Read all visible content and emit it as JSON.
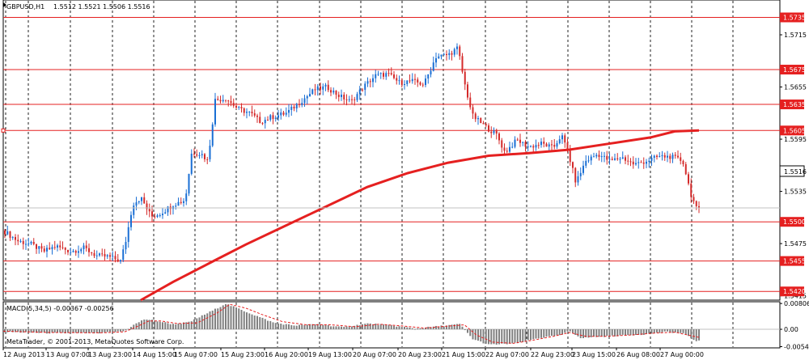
{
  "header": {
    "symbol_label": "GBPUSD,H1",
    "ohlc_label": "1.5512 1.5521 1.5506 1.5516"
  },
  "macd_label": "MACD(5,34,5) -0.00367 -0.00256",
  "copyright": "MetaTrader, © 2001-2013, MetaQuotes Software Corp.",
  "colors": {
    "bull": "#1a6fd4",
    "bear": "#d42a2a",
    "level": "#e52020",
    "ma": "#e52020",
    "grid": "#222222",
    "histogram": "#808080",
    "signal": "#e52020"
  },
  "chart_data": [
    {
      "type": "candlestick",
      "title": "GBPUSD,H1",
      "ylim": [
        1.541,
        1.5755
      ],
      "y_tick_labels": [
        "1.5715",
        "1.5655",
        "1.5595",
        "1.5535",
        "1.5475",
        "1.5415"
      ],
      "current_price": "1.5516",
      "horizontal_levels": [
        "1.5735",
        "1.5675",
        "1.5635",
        "1.5605",
        "1.5500",
        "1.5455",
        "1.5420"
      ],
      "x_tick_labels": [
        "12 Aug 2013",
        "13 Aug 07:00",
        "13 Aug 23:00",
        "14 Aug 15:00",
        "15 Aug 07:00",
        "15 Aug 23:00",
        "16 Aug 20:00",
        "19 Aug 13:00",
        "20 Aug 07:00",
        "20 Aug 23:00",
        "21 Aug 15:00",
        "22 Aug 07:00",
        "22 Aug 23:00",
        "23 Aug 15:00",
        "26 Aug 08:00",
        "27 Aug 00:00"
      ],
      "close_path": [
        [
          0,
          1.549
        ],
        [
          18,
          1.5478
        ],
        [
          35,
          1.5474
        ],
        [
          50,
          1.5466
        ],
        [
          65,
          1.5472
        ],
        [
          84,
          1.5466
        ],
        [
          100,
          1.547
        ],
        [
          115,
          1.5461
        ],
        [
          130,
          1.546
        ],
        [
          145,
          1.5455
        ],
        [
          152,
          1.548
        ],
        [
          160,
          1.552
        ],
        [
          170,
          1.5528
        ],
        [
          183,
          1.5506
        ],
        [
          195,
          1.551
        ],
        [
          210,
          1.552
        ],
        [
          225,
          1.5525
        ],
        [
          233,
          1.558
        ],
        [
          245,
          1.5578
        ],
        [
          253,
          1.557
        ],
        [
          262,
          1.564
        ],
        [
          275,
          1.5642
        ],
        [
          290,
          1.563
        ],
        [
          305,
          1.5625
        ],
        [
          318,
          1.5615
        ],
        [
          330,
          1.562
        ],
        [
          350,
          1.5625
        ],
        [
          370,
          1.564
        ],
        [
          385,
          1.5652
        ],
        [
          400,
          1.5655
        ],
        [
          415,
          1.5645
        ],
        [
          430,
          1.5638
        ],
        [
          445,
          1.5655
        ],
        [
          460,
          1.5668
        ],
        [
          475,
          1.567
        ],
        [
          490,
          1.566
        ],
        [
          505,
          1.5662
        ],
        [
          520,
          1.5658
        ],
        [
          535,
          1.569
        ],
        [
          550,
          1.5692
        ],
        [
          562,
          1.57
        ],
        [
          570,
          1.566
        ],
        [
          580,
          1.5622
        ],
        [
          595,
          1.561
        ],
        [
          610,
          1.56
        ],
        [
          620,
          1.558
        ],
        [
          635,
          1.5594
        ],
        [
          650,
          1.5586
        ],
        [
          665,
          1.559
        ],
        [
          680,
          1.5585
        ],
        [
          690,
          1.56
        ],
        [
          698,
          1.558
        ],
        [
          708,
          1.5545
        ],
        [
          720,
          1.557
        ],
        [
          735,
          1.5578
        ],
        [
          750,
          1.557
        ],
        [
          765,
          1.5574
        ],
        [
          780,
          1.5566
        ],
        [
          795,
          1.557
        ],
        [
          810,
          1.5575
        ],
        [
          825,
          1.5575
        ],
        [
          840,
          1.557
        ],
        [
          850,
          1.5532
        ],
        [
          858,
          1.5512
        ],
        [
          862,
          1.5516
        ]
      ],
      "moving_average": [
        [
          170,
          1.541
        ],
        [
          210,
          1.5431
        ],
        [
          260,
          1.5455
        ],
        [
          300,
          1.5474
        ],
        [
          350,
          1.5496
        ],
        [
          400,
          1.5518
        ],
        [
          450,
          1.554
        ],
        [
          500,
          1.5556
        ],
        [
          550,
          1.5568
        ],
        [
          600,
          1.5576
        ],
        [
          650,
          1.5579
        ],
        [
          700,
          1.5583
        ],
        [
          750,
          1.559
        ],
        [
          800,
          1.5597
        ],
        [
          830,
          1.5604
        ],
        [
          860,
          1.5605
        ]
      ]
    },
    {
      "type": "histogram",
      "title": "MACD(5,34,5)",
      "ylim": [
        -0.0058,
        0.0086
      ],
      "y_tick_labels": [
        "0.00806",
        "0.00",
        "-0.00542"
      ],
      "value": -0.00367,
      "signal_value": -0.00256,
      "macd_path": [
        [
          0,
          -0.0008
        ],
        [
          60,
          -0.0012
        ],
        [
          120,
          -0.0012
        ],
        [
          150,
          -0.0006
        ],
        [
          160,
          0.0012
        ],
        [
          175,
          0.0032
        ],
        [
          190,
          0.0026
        ],
        [
          210,
          0.0016
        ],
        [
          230,
          0.0022
        ],
        [
          260,
          0.006
        ],
        [
          275,
          0.008
        ],
        [
          290,
          0.0065
        ],
        [
          310,
          0.0045
        ],
        [
          335,
          0.002
        ],
        [
          360,
          0.0012
        ],
        [
          390,
          0.0016
        ],
        [
          420,
          0.0006
        ],
        [
          450,
          0.0018
        ],
        [
          480,
          0.0012
        ],
        [
          510,
          0.0002
        ],
        [
          540,
          0.001
        ],
        [
          565,
          0.0016
        ],
        [
          580,
          -0.003
        ],
        [
          600,
          -0.0048
        ],
        [
          620,
          -0.0046
        ],
        [
          640,
          -0.0042
        ],
        [
          660,
          -0.0028
        ],
        [
          690,
          -0.0018
        ],
        [
          700,
          -0.0005
        ],
        [
          715,
          -0.0028
        ],
        [
          730,
          -0.0024
        ],
        [
          760,
          -0.002
        ],
        [
          790,
          -0.0016
        ],
        [
          820,
          -0.0008
        ],
        [
          840,
          -0.0012
        ],
        [
          855,
          -0.0035
        ],
        [
          862,
          -0.0037
        ]
      ],
      "signal_path": [
        [
          0,
          -0.0006
        ],
        [
          60,
          -0.001
        ],
        [
          120,
          -0.0011
        ],
        [
          150,
          -0.0008
        ],
        [
          165,
          0.0008
        ],
        [
          180,
          0.0026
        ],
        [
          195,
          0.0026
        ],
        [
          215,
          0.0018
        ],
        [
          240,
          0.002
        ],
        [
          265,
          0.0052
        ],
        [
          280,
          0.0078
        ],
        [
          300,
          0.0066
        ],
        [
          320,
          0.0046
        ],
        [
          345,
          0.0024
        ],
        [
          375,
          0.0014
        ],
        [
          405,
          0.0014
        ],
        [
          435,
          0.0008
        ],
        [
          465,
          0.0016
        ],
        [
          495,
          0.001
        ],
        [
          520,
          0.0004
        ],
        [
          550,
          0.001
        ],
        [
          570,
          0.0014
        ],
        [
          585,
          -0.0018
        ],
        [
          605,
          -0.004
        ],
        [
          630,
          -0.0044
        ],
        [
          655,
          -0.0034
        ],
        [
          680,
          -0.0022
        ],
        [
          700,
          -0.001
        ],
        [
          720,
          -0.0022
        ],
        [
          745,
          -0.0022
        ],
        [
          775,
          -0.0018
        ],
        [
          805,
          -0.0012
        ],
        [
          830,
          -0.0009
        ],
        [
          850,
          -0.002
        ],
        [
          862,
          -0.0026
        ]
      ]
    }
  ]
}
